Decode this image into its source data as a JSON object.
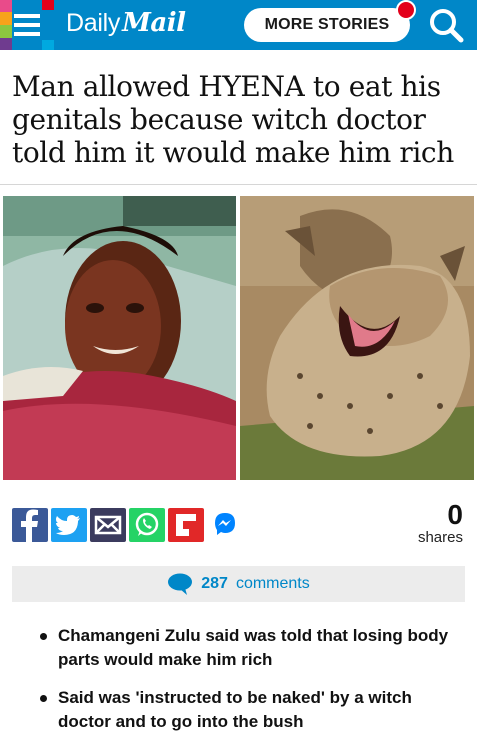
{
  "header": {
    "logo_part1": "Daily",
    "logo_part2": "Mail",
    "more_stories": "MORE STORIES",
    "brand_color": "#0087c8",
    "notification_color": "#e3001b",
    "menu_icon": "hamburger-menu-icon",
    "search_icon": "search-icon"
  },
  "article": {
    "headline": "Man allowed HYENA to eat his genitals because witch doctor told him it would make him rich",
    "photos": [
      "man-in-hospital-bed-photo",
      "hyenas-photo"
    ]
  },
  "share": {
    "buttons": [
      "facebook-icon",
      "twitter-icon",
      "email-icon",
      "whatsapp-icon",
      "flipboard-icon",
      "messenger-icon"
    ],
    "count": "0",
    "count_label": "shares"
  },
  "comments": {
    "icon": "speech-bubble-icon",
    "count": "287",
    "label": "comments"
  },
  "bullets": [
    "Chamangeni Zulu said was told that losing body parts would make him rich",
    "Said was 'instructed to be naked' by a witch doctor and to go into the bush"
  ]
}
